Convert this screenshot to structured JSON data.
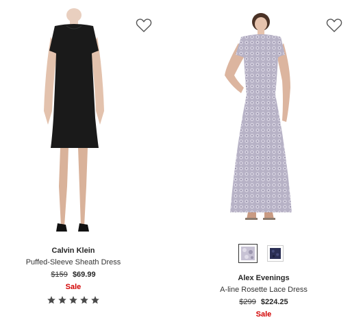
{
  "products": [
    {
      "brand": "Calvin Klein",
      "name": "Puffed-Sleeve Sheath Dress",
      "original_price": "$159",
      "sale_price": "$69.99",
      "sale_label": "Sale",
      "rating_stars": 5,
      "image_icon": "black-sheath-dress-image",
      "wishlist_icon": "heart-outline-icon"
    },
    {
      "brand": "Alex Evenings",
      "name": "A-line Rosette Lace Dress",
      "original_price": "$299",
      "sale_price": "$224.25",
      "sale_label": "Sale",
      "image_icon": "lavender-lace-gown-image",
      "wishlist_icon": "heart-outline-icon",
      "swatches": [
        {
          "color_name": "lavender-lace",
          "color": "#b9b4c8",
          "selected": true
        },
        {
          "color_name": "navy-lace",
          "color": "#2b2f55",
          "selected": false
        }
      ]
    }
  ],
  "colors": {
    "sale_red": "#d20000",
    "text_dark": "#262626",
    "star_gray": "#4a4a4a"
  }
}
